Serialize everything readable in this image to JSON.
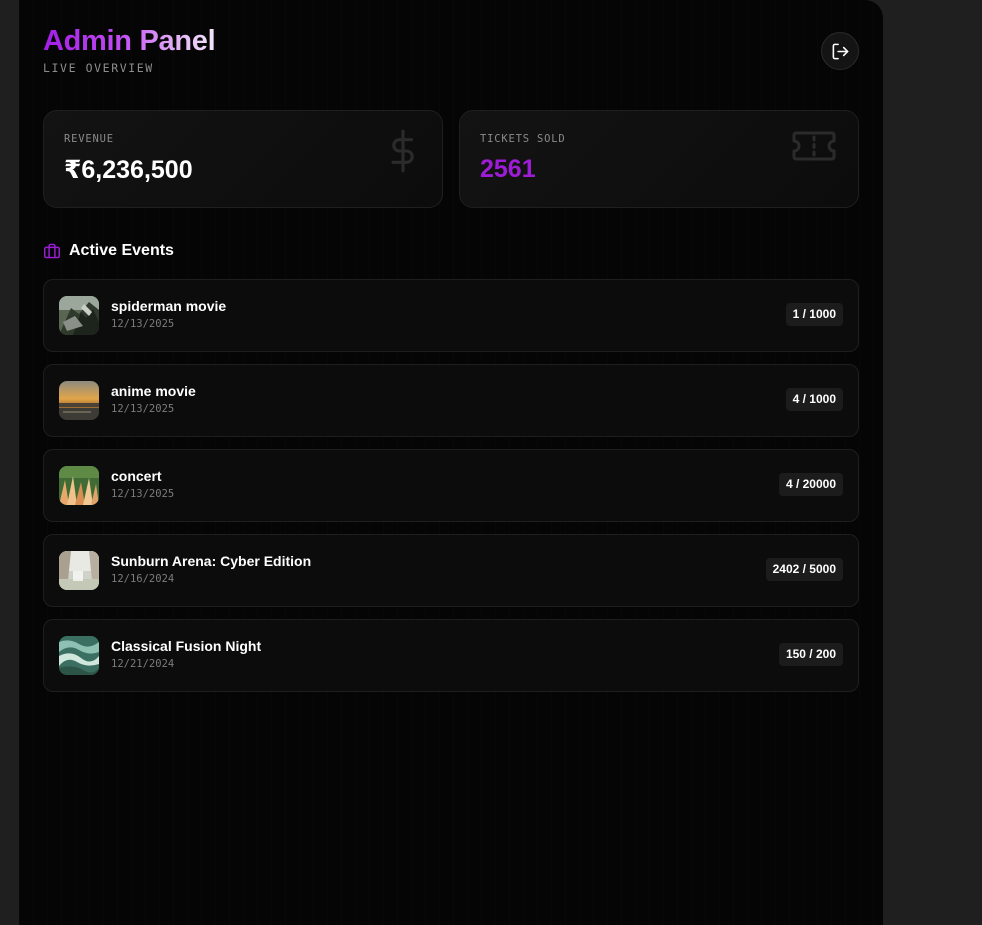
{
  "header": {
    "title_part1": "Admin ",
    "title_part2": "Panel",
    "subtitle": "LIVE OVERVIEW",
    "logout_icon": "logout-icon"
  },
  "stats": {
    "revenue": {
      "label": "REVENUE",
      "value": "₹6,236,500",
      "icon": "dollar-icon"
    },
    "tickets": {
      "label": "TICKETS SOLD",
      "value": "2561",
      "icon": "ticket-icon"
    }
  },
  "active_events": {
    "title": "Active Events",
    "icon": "briefcase-icon",
    "items": [
      {
        "name": "spiderman movie",
        "date": "12/13/2025",
        "count": "1 / 1000"
      },
      {
        "name": "anime movie",
        "date": "12/13/2025",
        "count": "4 / 1000"
      },
      {
        "name": "concert",
        "date": "12/13/2025",
        "count": "4 / 20000"
      },
      {
        "name": "Sunburn Arena: Cyber Edition",
        "date": "12/16/2024",
        "count": "2402 / 5000"
      },
      {
        "name": "Classical Fusion Night",
        "date": "12/21/2024",
        "count": "150 / 200"
      }
    ]
  },
  "colors": {
    "accent": "#9d1dd6",
    "background": "#050505",
    "card": "#0c0c0c"
  }
}
